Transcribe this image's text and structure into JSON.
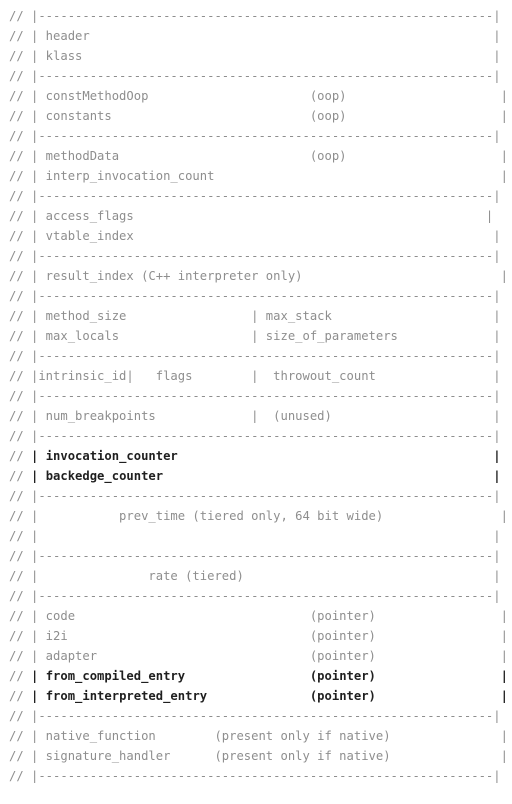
{
  "document": {
    "kind": "source-code-comment",
    "language": "C++",
    "comment_marker": "//",
    "title": "methodOop memory layout diagram",
    "box_width_chars": 64,
    "text_color": "#8e8e8e",
    "emphasis_color": "#1f1f1f",
    "background_color": "#ffffff"
  },
  "lines": [
    {
      "id": "rule-top",
      "type": "rule",
      "text": "// |--------------------------------------------------------------|"
    },
    {
      "id": "row-header",
      "type": "field",
      "text": "// | header                                                       |"
    },
    {
      "id": "row-klass",
      "type": "field",
      "text": "// | klass                                                        |"
    },
    {
      "id": "rule-1",
      "type": "rule",
      "text": "// |--------------------------------------------------------------|"
    },
    {
      "id": "row-constmethodoop",
      "type": "field",
      "text": "// | constMethodOop                      (oop)                     |"
    },
    {
      "id": "row-constants",
      "type": "field",
      "text": "// | constants                           (oop)                     |"
    },
    {
      "id": "rule-2",
      "type": "rule",
      "text": "// |--------------------------------------------------------------|"
    },
    {
      "id": "row-methoddata",
      "type": "field",
      "text": "// | methodData                          (oop)                     |"
    },
    {
      "id": "row-interp-inv-count",
      "type": "field",
      "text": "// | interp_invocation_count                                       |"
    },
    {
      "id": "rule-3",
      "type": "rule",
      "text": "// |--------------------------------------------------------------|"
    },
    {
      "id": "row-access-flags",
      "type": "field",
      "text": "// | access_flags                                                |"
    },
    {
      "id": "row-vtable-index",
      "type": "field",
      "text": "// | vtable_index                                                 |"
    },
    {
      "id": "rule-4",
      "type": "rule",
      "text": "// |--------------------------------------------------------------|"
    },
    {
      "id": "row-result-index",
      "type": "field",
      "text": "// | result_index (C++ interpreter only)                           |"
    },
    {
      "id": "rule-5",
      "type": "rule",
      "text": "// |--------------------------------------------------------------|"
    },
    {
      "id": "row-method-size",
      "type": "field",
      "text": "// | method_size                 | max_stack                      |"
    },
    {
      "id": "row-max-locals",
      "type": "field",
      "text": "// | max_locals                  | size_of_parameters             |"
    },
    {
      "id": "rule-6",
      "type": "rule",
      "text": "// |--------------------------------------------------------------|"
    },
    {
      "id": "row-intrinsic-id",
      "type": "field",
      "text": "// |intrinsic_id|   flags        |  throwout_count                |"
    },
    {
      "id": "rule-7",
      "type": "rule",
      "text": "// |--------------------------------------------------------------|"
    },
    {
      "id": "row-num-breakpoints",
      "type": "field",
      "text": "// | num_breakpoints             |  (unused)                      |"
    },
    {
      "id": "rule-8",
      "type": "rule",
      "text": "// |--------------------------------------------------------------|"
    },
    {
      "id": "row-invocation-counter",
      "type": "field",
      "text": "// | invocation_counter                                           |",
      "emphasis": true,
      "label": "invocation_counter"
    },
    {
      "id": "row-backedge-counter",
      "type": "field",
      "text": "// | backedge_counter                                             |",
      "emphasis": true,
      "label": "backedge_counter"
    },
    {
      "id": "rule-9",
      "type": "rule",
      "text": "// |--------------------------------------------------------------|"
    },
    {
      "id": "row-prev-time",
      "type": "field",
      "text": "// |           prev_time (tiered only, 64 bit wide)                |"
    },
    {
      "id": "row-prev-time-cont",
      "type": "field",
      "text": "// |                                                              |"
    },
    {
      "id": "rule-10",
      "type": "rule",
      "text": "// |--------------------------------------------------------------|"
    },
    {
      "id": "row-rate",
      "type": "field",
      "text": "// |               rate (tiered)                                  |"
    },
    {
      "id": "rule-11",
      "type": "rule",
      "text": "// |--------------------------------------------------------------|"
    },
    {
      "id": "row-code",
      "type": "field",
      "text": "// | code                                (pointer)                 |"
    },
    {
      "id": "row-i2i",
      "type": "field",
      "text": "// | i2i                                 (pointer)                 |"
    },
    {
      "id": "row-adapter",
      "type": "field",
      "text": "// | adapter                             (pointer)                 |"
    },
    {
      "id": "row-from-compiled",
      "type": "field",
      "text": "// | from_compiled_entry                 (pointer)                 |",
      "emphasis": true,
      "label": "from_compiled_entry"
    },
    {
      "id": "row-from-interpreted",
      "type": "field",
      "text": "// | from_interpreted_entry              (pointer)                 |",
      "emphasis": true,
      "label": "from_interpreted_entry"
    },
    {
      "id": "rule-12",
      "type": "rule",
      "text": "// |--------------------------------------------------------------|"
    },
    {
      "id": "row-native-function",
      "type": "field",
      "text": "// | native_function        (present only if native)               |"
    },
    {
      "id": "row-signature-handler",
      "type": "field",
      "text": "// | signature_handler      (present only if native)               |"
    },
    {
      "id": "rule-bottom",
      "type": "rule",
      "text": "// |--------------------------------------------------------------|"
    }
  ],
  "fields": [
    "header",
    "klass",
    "constMethodOop",
    "constants",
    "methodData",
    "interp_invocation_count",
    "access_flags",
    "vtable_index",
    "result_index",
    "method_size",
    "max_stack",
    "max_locals",
    "size_of_parameters",
    "intrinsic_id",
    "flags",
    "throwout_count",
    "num_breakpoints",
    "unused",
    "invocation_counter",
    "backedge_counter",
    "prev_time",
    "rate",
    "code",
    "i2i",
    "adapter",
    "from_compiled_entry",
    "from_interpreted_entry",
    "native_function",
    "signature_handler"
  ],
  "annotations": {
    "oop": "(oop)",
    "pointer": "(pointer)",
    "unused": "(unused)",
    "cpp_interpreter_only": "(C++ interpreter only)",
    "tiered_only_64bit": "(tiered only, 64 bit wide)",
    "tiered": "(tiered)",
    "present_only_if_native": "(present only if native)"
  }
}
